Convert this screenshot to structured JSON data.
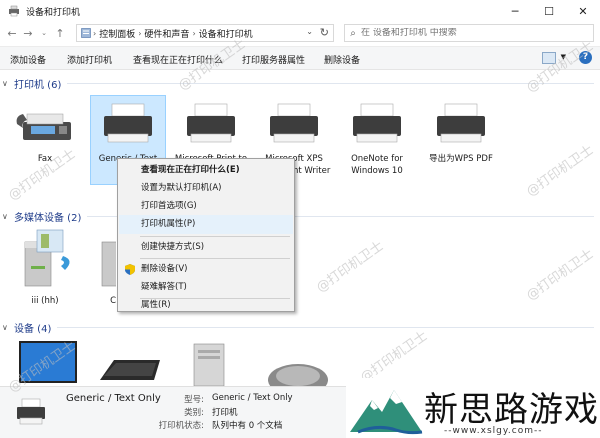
{
  "window": {
    "title": "设备和打印机",
    "minimize": "─",
    "maximize": "☐",
    "close": "✕"
  },
  "address": {
    "crumbs": [
      "控制面板",
      "硬件和声音",
      "设备和打印机"
    ]
  },
  "search": {
    "placeholder": "在 设备和打印机 中搜索"
  },
  "toolbar": {
    "add_device": "添加设备",
    "add_printer": "添加打印机",
    "see_printing": "查看现在正在打印什么",
    "print_server_props": "打印服务器属性",
    "remove_device": "删除设备"
  },
  "groups": {
    "printers": {
      "title": "打印机 (6)",
      "items": [
        {
          "label": "Fax"
        },
        {
          "label": "Generic / Text Only"
        },
        {
          "label": "Microsoft Print to PDF"
        },
        {
          "label": "Microsoft XPS Document Writer"
        },
        {
          "label": "OneNote for Windows 10"
        },
        {
          "label": "导出为WPS PDF"
        }
      ]
    },
    "media": {
      "title": "多媒体设备 (2)",
      "items": [
        {
          "label": "iii (hh)"
        },
        {
          "label": "C"
        }
      ]
    },
    "devices": {
      "title": "设备 (4)"
    }
  },
  "context_menu": {
    "items": [
      "查看现在正在打印什么(E)",
      "设置为默认打印机(A)",
      "打印首选项(G)",
      "打印机属性(P)",
      "创建快捷方式(S)",
      "删除设备(V)",
      "疑难解答(T)",
      "属性(R)"
    ]
  },
  "details": {
    "name": "Generic / Text Only",
    "model_key": "型号:",
    "model_val": "Generic / Text Only",
    "category_key": "类别:",
    "category_val": "打印机",
    "status_key": "打印机状态:",
    "status_val": "队列中有 0 个文档"
  },
  "watermark": "@打印机卫士",
  "brand": {
    "name": "新思路游戏",
    "url": "--www.xslgy.com--"
  },
  "colors": {
    "accent": "#1f3c8a",
    "selection": "#cce8ff",
    "menu_hover": "#e5f1fb"
  }
}
